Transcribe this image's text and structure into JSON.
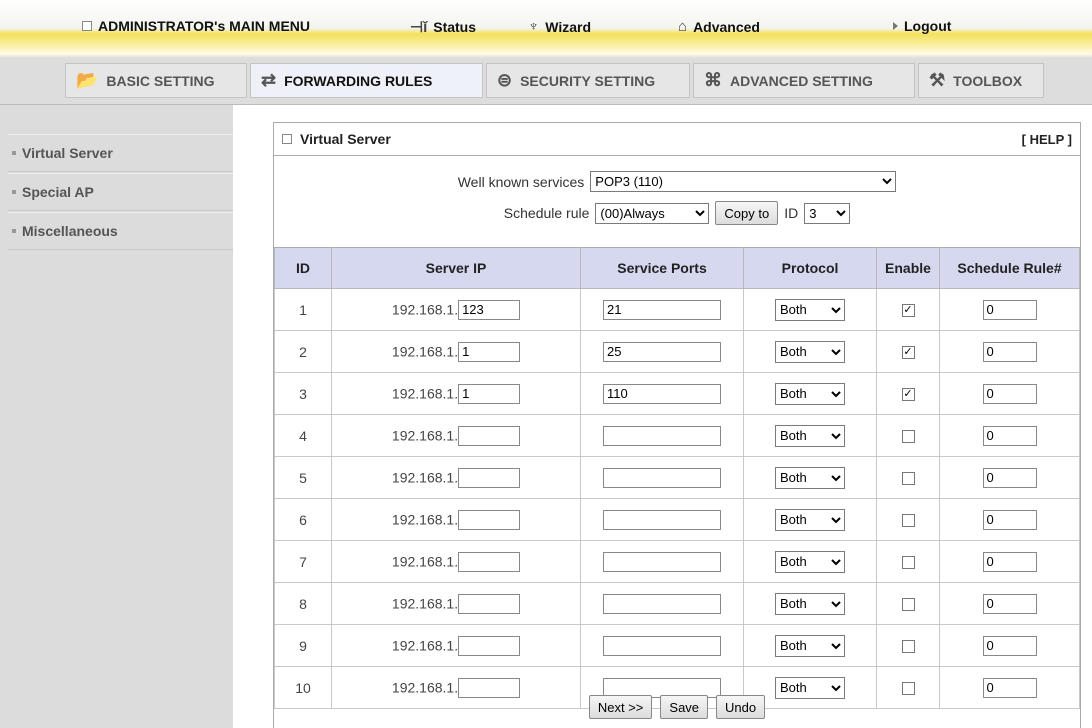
{
  "topmenu": {
    "admin": "ADMINISTRATOR's MAIN MENU",
    "status": "Status",
    "wizard": "Wizard",
    "advanced": "Advanced",
    "logout": "Logout"
  },
  "subnav": {
    "tabs": [
      {
        "label": "BASIC SETTING",
        "icon": "folder-icon"
      },
      {
        "label": "FORWARDING RULES",
        "icon": "arrows-icon"
      },
      {
        "label": "SECURITY SETTING",
        "icon": "lock-icon"
      },
      {
        "label": "ADVANCED SETTING",
        "icon": "wrench-icon"
      },
      {
        "label": "TOOLBOX",
        "icon": "toolbox-icon"
      }
    ],
    "active": "FORWARDING RULES"
  },
  "sidebar": {
    "items": [
      {
        "label": "Virtual Server"
      },
      {
        "label": "Special AP"
      },
      {
        "label": "Miscellaneous"
      }
    ]
  },
  "panel": {
    "title": "Virtual Server",
    "help": "[ HELP ]",
    "well_known_label": "Well known services",
    "well_known_value": "POP3 (110)",
    "schedule_label": "Schedule rule",
    "schedule_value": "(00)Always",
    "copy_to": "Copy to",
    "id_label": "ID",
    "id_value": "3"
  },
  "table": {
    "headers": [
      "ID",
      "Server IP",
      "Service Ports",
      "Protocol",
      "Enable",
      "Schedule Rule#"
    ],
    "ip_prefix": "192.168.1.",
    "rows": [
      {
        "id": "1",
        "ip": "123",
        "port": "21",
        "protocol": "Both",
        "enable": true,
        "sched": "0"
      },
      {
        "id": "2",
        "ip": "1",
        "port": "25",
        "protocol": "Both",
        "enable": true,
        "sched": "0"
      },
      {
        "id": "3",
        "ip": "1",
        "port": "110",
        "protocol": "Both",
        "enable": true,
        "sched": "0"
      },
      {
        "id": "4",
        "ip": "",
        "port": "",
        "protocol": "Both",
        "enable": false,
        "sched": "0"
      },
      {
        "id": "5",
        "ip": "",
        "port": "",
        "protocol": "Both",
        "enable": false,
        "sched": "0"
      },
      {
        "id": "6",
        "ip": "",
        "port": "",
        "protocol": "Both",
        "enable": false,
        "sched": "0"
      },
      {
        "id": "7",
        "ip": "",
        "port": "",
        "protocol": "Both",
        "enable": false,
        "sched": "0"
      },
      {
        "id": "8",
        "ip": "",
        "port": "",
        "protocol": "Both",
        "enable": false,
        "sched": "0"
      },
      {
        "id": "9",
        "ip": "",
        "port": "",
        "protocol": "Both",
        "enable": false,
        "sched": "0"
      },
      {
        "id": "10",
        "ip": "",
        "port": "",
        "protocol": "Both",
        "enable": false,
        "sched": "0"
      }
    ]
  },
  "buttons": {
    "next": "Next >>",
    "save": "Save",
    "undo": "Undo"
  }
}
